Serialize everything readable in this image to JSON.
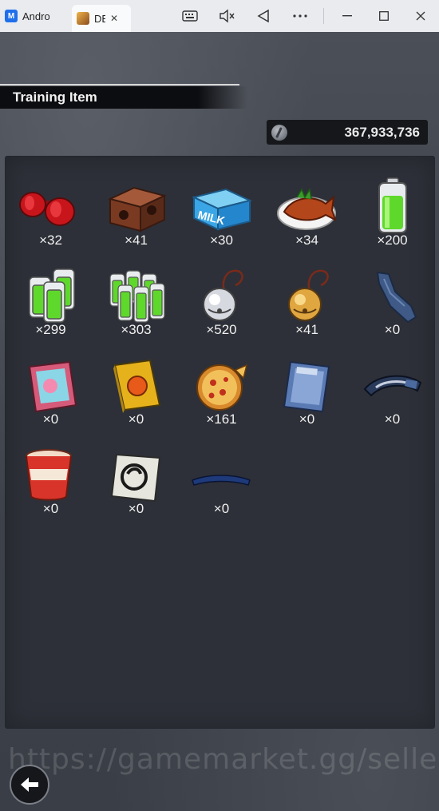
{
  "window": {
    "tabs": [
      {
        "label": "Andro",
        "color": "#1f6feb"
      },
      {
        "label": "DB",
        "color": "#c8842a"
      }
    ],
    "controls": [
      "keyboard-icon",
      "mute-icon",
      "back-triangle-icon",
      "more-icon",
      "minimize-icon",
      "maximize-icon",
      "close-icon"
    ]
  },
  "header": {
    "title": "Training Item"
  },
  "currency": {
    "value": "367,933,736",
    "icon": "zeni-coin-icon"
  },
  "items": [
    {
      "name": "red-dumbbell",
      "qty": "×32"
    },
    {
      "name": "brick-weight",
      "qty": "×41"
    },
    {
      "name": "milk-carton",
      "qty": "×30"
    },
    {
      "name": "roast-fish",
      "qty": "×34"
    },
    {
      "name": "battery",
      "qty": "×200"
    },
    {
      "name": "battery-pack",
      "qty": "×299"
    },
    {
      "name": "battery-crate",
      "qty": "×303"
    },
    {
      "name": "silver-bell",
      "qty": "×520"
    },
    {
      "name": "gold-bell",
      "qty": "×41"
    },
    {
      "name": "blue-scarf",
      "qty": "×0"
    },
    {
      "name": "pink-magazine",
      "qty": "×0"
    },
    {
      "name": "yellow-book",
      "qty": "×0"
    },
    {
      "name": "pizza",
      "qty": "×161"
    },
    {
      "name": "comic-book",
      "qty": "×0"
    },
    {
      "name": "visor",
      "qty": "×0"
    },
    {
      "name": "cup-noodle",
      "qty": "×0"
    },
    {
      "name": "saiyan-patch",
      "qty": "×0"
    },
    {
      "name": "blue-band",
      "qty": "×0"
    }
  ],
  "watermark": "https://gamemarket.gg/seller/"
}
